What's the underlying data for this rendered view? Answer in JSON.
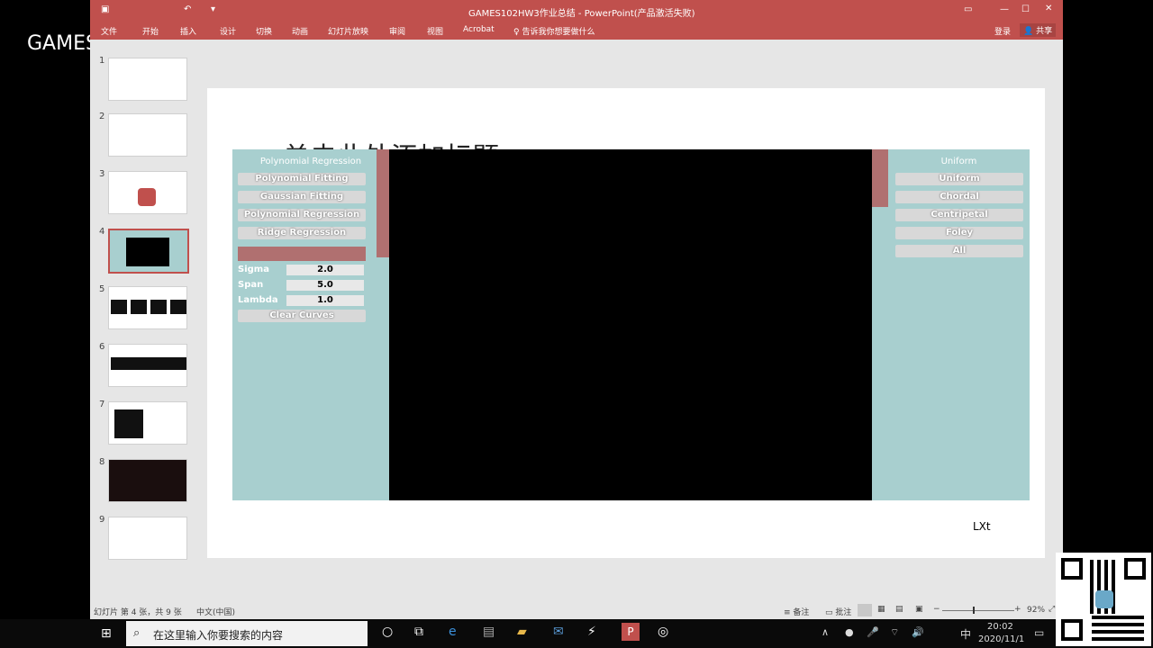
{
  "window": {
    "title": "GAMES102HW3作业总结 - PowerPoint(产品激活失败)",
    "signin": "登录",
    "share": "共享"
  },
  "ribbon": [
    "文件",
    "开始",
    "插入",
    "设计",
    "切换",
    "动画",
    "幻灯片放映",
    "审阅",
    "视图",
    "Acrobat",
    "♀ 告诉我你想要做什么"
  ],
  "watermark": "GAMES-Webinar",
  "thumbnails": [
    {
      "num": "1"
    },
    {
      "num": "2"
    },
    {
      "num": "3"
    },
    {
      "num": "4"
    },
    {
      "num": "5"
    },
    {
      "num": "6"
    },
    {
      "num": "7"
    },
    {
      "num": "8"
    },
    {
      "num": "9"
    }
  ],
  "slide": {
    "title": "单击此处添加标题",
    "author": "LXt"
  },
  "app_left": {
    "header": "Polynomial Regression",
    "buttons": [
      "Polynomial Fitting",
      "Gaussian Fitting",
      "Polynomial Regression",
      "Ridge Regression"
    ],
    "params": [
      {
        "label": "Sigma",
        "value": "2.0"
      },
      {
        "label": "Span",
        "value": "5.0"
      },
      {
        "label": "Lambda",
        "value": "1.0"
      }
    ],
    "clear": "Clear Curves"
  },
  "app_right": {
    "header": "Uniform",
    "buttons": [
      "Uniform",
      "Chordal",
      "Centripetal",
      "Foley",
      "All"
    ]
  },
  "status": {
    "slide_info": "幻灯片 第 4 张，共 9 张",
    "language": "中文(中国)",
    "notes": "备注",
    "comments": "批注",
    "zoom": "92%"
  },
  "taskbar": {
    "search_placeholder": "在这里输入你要搜索的内容",
    "ime": "中",
    "time": "20:02",
    "date": "2020/11/1"
  },
  "colors": {
    "accent": "#c0504d",
    "app_bg": "#a8cfcf",
    "canvas": "#000000"
  }
}
